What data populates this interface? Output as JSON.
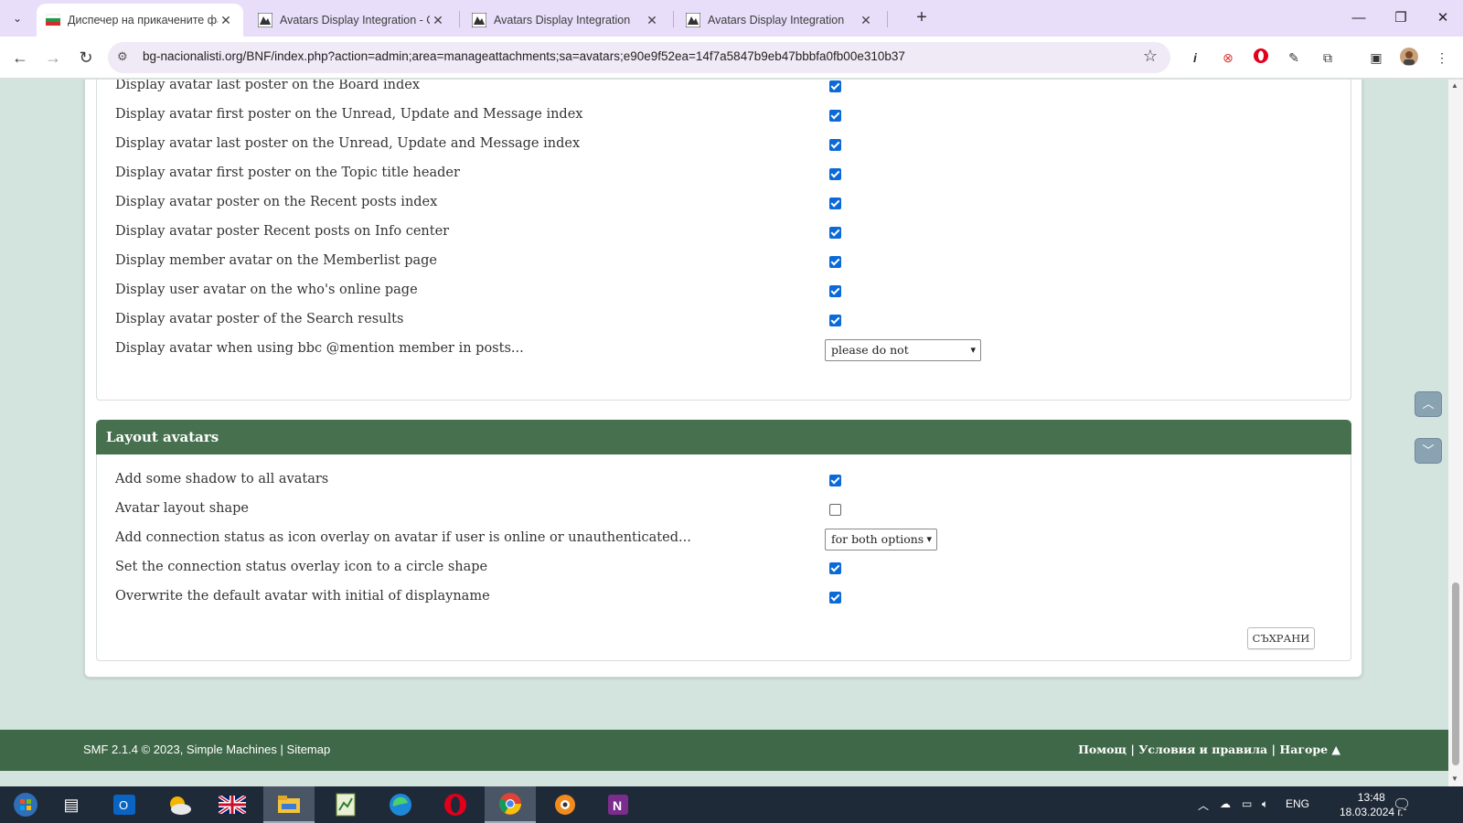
{
  "browser": {
    "tabs": [
      {
        "title": "Диспечер на прикачените фа",
        "active": true
      },
      {
        "title": "Avatars Display Integration - Ст",
        "active": false
      },
      {
        "title": "Avatars Display Integration",
        "active": false
      },
      {
        "title": "Avatars Display Integration",
        "active": false
      }
    ],
    "url": "bg-nacionalisti.org/BNF/index.php?action=admin;area=manageattachments;sa=avatars;e90e9f52ea=14f7a5847b9eb47bbbfa0fb00e310b37"
  },
  "settings_display": {
    "rows": [
      {
        "label": "Display avatar last poster on the Board index",
        "checked": true
      },
      {
        "label": "Display avatar first poster on the Unread, Update and Message index",
        "checked": true
      },
      {
        "label": "Display avatar last poster on the Unread, Update and Message index",
        "checked": true
      },
      {
        "label": "Display avatar first poster on the Topic title header",
        "checked": true
      },
      {
        "label": "Display avatar poster on the Recent posts index",
        "checked": true
      },
      {
        "label": "Display avatar poster Recent posts on Info center",
        "checked": true
      },
      {
        "label": "Display member avatar on the Memberlist page",
        "checked": true
      },
      {
        "label": "Display user avatar on the who's online page",
        "checked": true
      },
      {
        "label": "Display avatar poster of the Search results",
        "checked": true
      }
    ],
    "mention": {
      "label": "Display avatar when using bbc @mention member in posts...",
      "value": "please do not"
    }
  },
  "layout_avatars": {
    "header": "Layout avatars",
    "rows": [
      {
        "label": "Add some shadow to all avatars",
        "checked": true
      },
      {
        "label": "Avatar layout shape",
        "checked": false
      }
    ],
    "connection": {
      "label": "Add connection status as icon overlay on avatar if user is online or unauthenticated...",
      "value": "for both options"
    },
    "rows2": [
      {
        "label": "Set the connection status overlay icon to a circle shape",
        "checked": true
      },
      {
        "label": "Overwrite the default avatar with initial of displayname",
        "checked": true
      }
    ],
    "save_label": "СЪХРАНИ"
  },
  "footer": {
    "copyright": "SMF 2.1.4 © 2023, Simple Machines",
    "sitemap": "Sitemap",
    "help": "Помощ",
    "terms": "Условия и правила",
    "top": "Нагоре ▲"
  },
  "taskbar": {
    "lang": "ENG",
    "time": "13:48",
    "date": "18.03.2024 г."
  }
}
